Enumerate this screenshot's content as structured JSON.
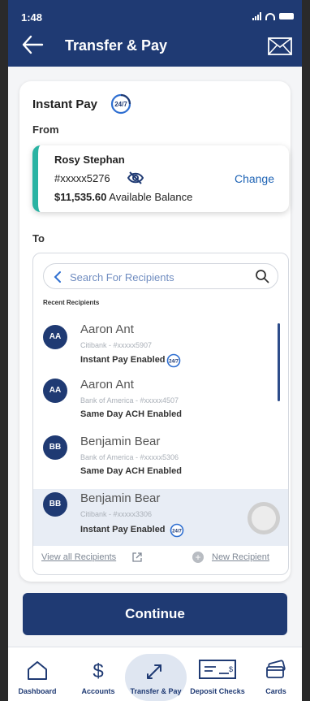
{
  "status": {
    "time": "1:48"
  },
  "header": {
    "title": "Transfer & Pay",
    "back_icon": "arrow-left-icon",
    "mail_icon": "envelope-icon"
  },
  "instant_pay": {
    "title": "Instant Pay",
    "badge": "24/7"
  },
  "from": {
    "label": "From",
    "account_name": "Rosy Stephan",
    "account_number": "#xxxxx5276",
    "balance": "$11,535.60",
    "balance_suffix": "Available Balance",
    "change_label": "Change"
  },
  "to": {
    "label": "To",
    "search_placeholder": "Search For Recipients",
    "recent_label": "Recent Recipients",
    "recipients": [
      {
        "initials": "AA",
        "name": "Aaron Ant",
        "bank": "Citibank - #xxxxx5907",
        "status": "Instant Pay Enabled",
        "badge": "24/7"
      },
      {
        "initials": "AA",
        "name": "Aaron Ant",
        "bank": "Bank of America - #xxxxx4507",
        "status": "Same Day ACH Enabled"
      },
      {
        "initials": "BB",
        "name": "Benjamin Bear",
        "bank": "Bank of America - #xxxxx5306",
        "status": "Same Day ACH Enabled"
      },
      {
        "initials": "BB",
        "name": "Benjamin Bear",
        "bank": "Citibank - #xxxxx3306",
        "status": "Instant Pay Enabled",
        "badge": "24/7"
      }
    ],
    "view_all_label": "View all Recipients",
    "new_recipient_label": "New Recipient"
  },
  "continue_label": "Continue",
  "nav": [
    {
      "label": "Dashboard",
      "icon": "home-icon"
    },
    {
      "label": "Accounts",
      "icon": "dollar-icon"
    },
    {
      "label": "Transfer & Pay",
      "icon": "transfer-arrows-icon",
      "active": true
    },
    {
      "label": "Deposit Checks",
      "icon": "check-icon"
    },
    {
      "label": "Cards",
      "icon": "cards-icon"
    }
  ],
  "colors": {
    "primary": "#1f3a73",
    "accent_teal": "#2ab3a3",
    "link": "#1f64b5"
  }
}
